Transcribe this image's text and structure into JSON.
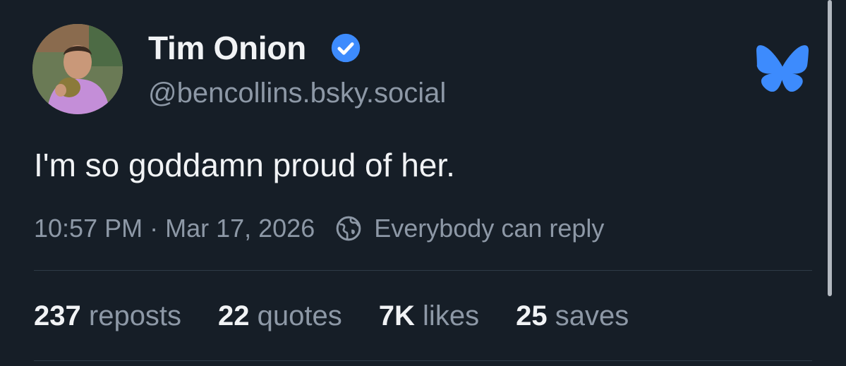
{
  "author": {
    "display_name": "Tim Onion",
    "handle": "@bencollins.bsky.social",
    "verified": true,
    "avatar_icon": "user-avatar"
  },
  "post": {
    "text": "I'm so goddamn proud of her.",
    "time": "10:57 PM",
    "separator": "·",
    "date": "Mar 17, 2026",
    "reply_setting": "Everybody can reply"
  },
  "stats": {
    "reposts_count": "237",
    "reposts_label": "reposts",
    "quotes_count": "22",
    "quotes_label": "quotes",
    "likes_count": "7K",
    "likes_label": "likes",
    "saves_count": "25",
    "saves_label": "saves"
  },
  "colors": {
    "background": "#161e27",
    "primary_text": "#f1f3f5",
    "secondary_text": "#8d98a6",
    "accent": "#3d8bfd",
    "divider": "#2e3a47"
  },
  "icons": {
    "verified": "verified-badge-icon",
    "brand": "bluesky-butterfly-icon",
    "reply": "globe-icon"
  }
}
